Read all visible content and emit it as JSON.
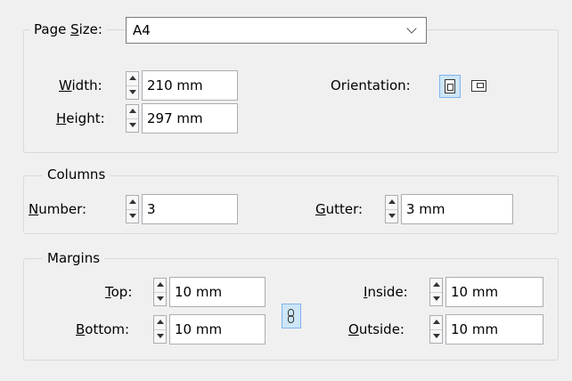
{
  "page_size": {
    "label_pre": "Page ",
    "label_key": "S",
    "label_post": "ize:",
    "value": "A4"
  },
  "width": {
    "label_key": "W",
    "label_post": "idth:",
    "value": "210 mm"
  },
  "height": {
    "label_key": "H",
    "label_post": "eight:",
    "value": "297 mm"
  },
  "orientation": {
    "label": "Orientation:",
    "selected": "portrait"
  },
  "columns": {
    "legend": "Columns",
    "number": {
      "label_key": "N",
      "label_post": "umber:",
      "value": "3"
    },
    "gutter": {
      "label_key": "G",
      "label_post": "utter:",
      "value": "3 mm"
    }
  },
  "margins": {
    "legend": "Margins",
    "top": {
      "label_key": "T",
      "label_post": "op:",
      "value": "10 mm"
    },
    "bottom": {
      "label_key": "B",
      "label_post": "ottom:",
      "value": "10 mm"
    },
    "inside": {
      "label_key": "I",
      "label_post": "nside:",
      "value": "10 mm"
    },
    "outside": {
      "label_key": "O",
      "label_post": "utside:",
      "value": "10 mm"
    },
    "linked": true
  },
  "colors": {
    "background": "#f0f0f0",
    "active_button": "#cde6f7",
    "active_border": "#7eb4ea"
  }
}
